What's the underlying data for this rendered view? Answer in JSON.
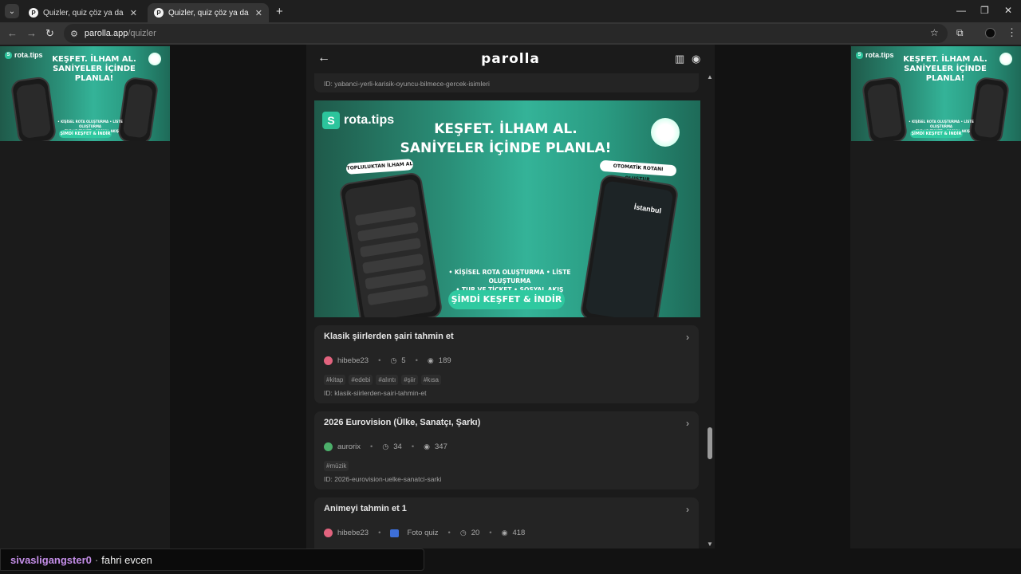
{
  "browser": {
    "tabs": [
      {
        "title": "Quizler, quiz çöz ya da quiz olu...",
        "active": false
      },
      {
        "title": "Quizler, quiz çöz ya da quiz olu...",
        "active": true
      }
    ],
    "url_host": "parolla.app",
    "url_path": "/quizler"
  },
  "ad": {
    "brand": "rota.tips",
    "headline_line1": "KEŞFET. İLHAM AL.",
    "headline_line2": "SANİYELER İÇİNDE PLANLA!",
    "tag_left": "TOPLULUKTAN İLHAM AL",
    "tag_right": "OTOMATİK ROTANI OLUŞTUR",
    "features_line1": "• KİŞİSEL ROTA OLUŞTURMA • LİSTE OLUŞTURMA",
    "features_line2": "• TUR VE TİCKET • SOSYAL AKIŞ",
    "cta": "ŞİMDİ KEŞFET & İNDİR",
    "city": "İstanbul"
  },
  "app": {
    "brand": "parolla",
    "prev_id": "ID: yabanci-yerli-karisik-oyuncu-bilmece-gercek-isimleri"
  },
  "quizzes": [
    {
      "title": "Klasik şiirlerden şairi tahmin et",
      "author": "hibebe23",
      "questions": "5",
      "views": "189",
      "tags": [
        "#kitap",
        "#edebi",
        "#alıntı",
        "#şiir",
        "#kısa"
      ],
      "id": "ID: klasik-siirlerden-sairi-tahmin-et"
    },
    {
      "title": "2026 Eurovision (Ülke, Sanatçı, Şarkı)",
      "author": "aurorix",
      "questions": "34",
      "views": "347",
      "tags": [
        "#müzik"
      ],
      "id": "ID: 2026-eurovision-uelke-sanatci-sarki"
    },
    {
      "title": "Animeyi tahmin et 1",
      "author": "hibebe23",
      "type": "Foto quiz",
      "questions": "20",
      "views": "418"
    }
  ],
  "chat": {
    "user": "sivasligangster0",
    "message": "fahri evcen"
  },
  "colors": {
    "accent_green": "#2fc9a0",
    "page_bg": "#121212",
    "card_bg": "#242424",
    "chat_user": "#c48ee8"
  }
}
